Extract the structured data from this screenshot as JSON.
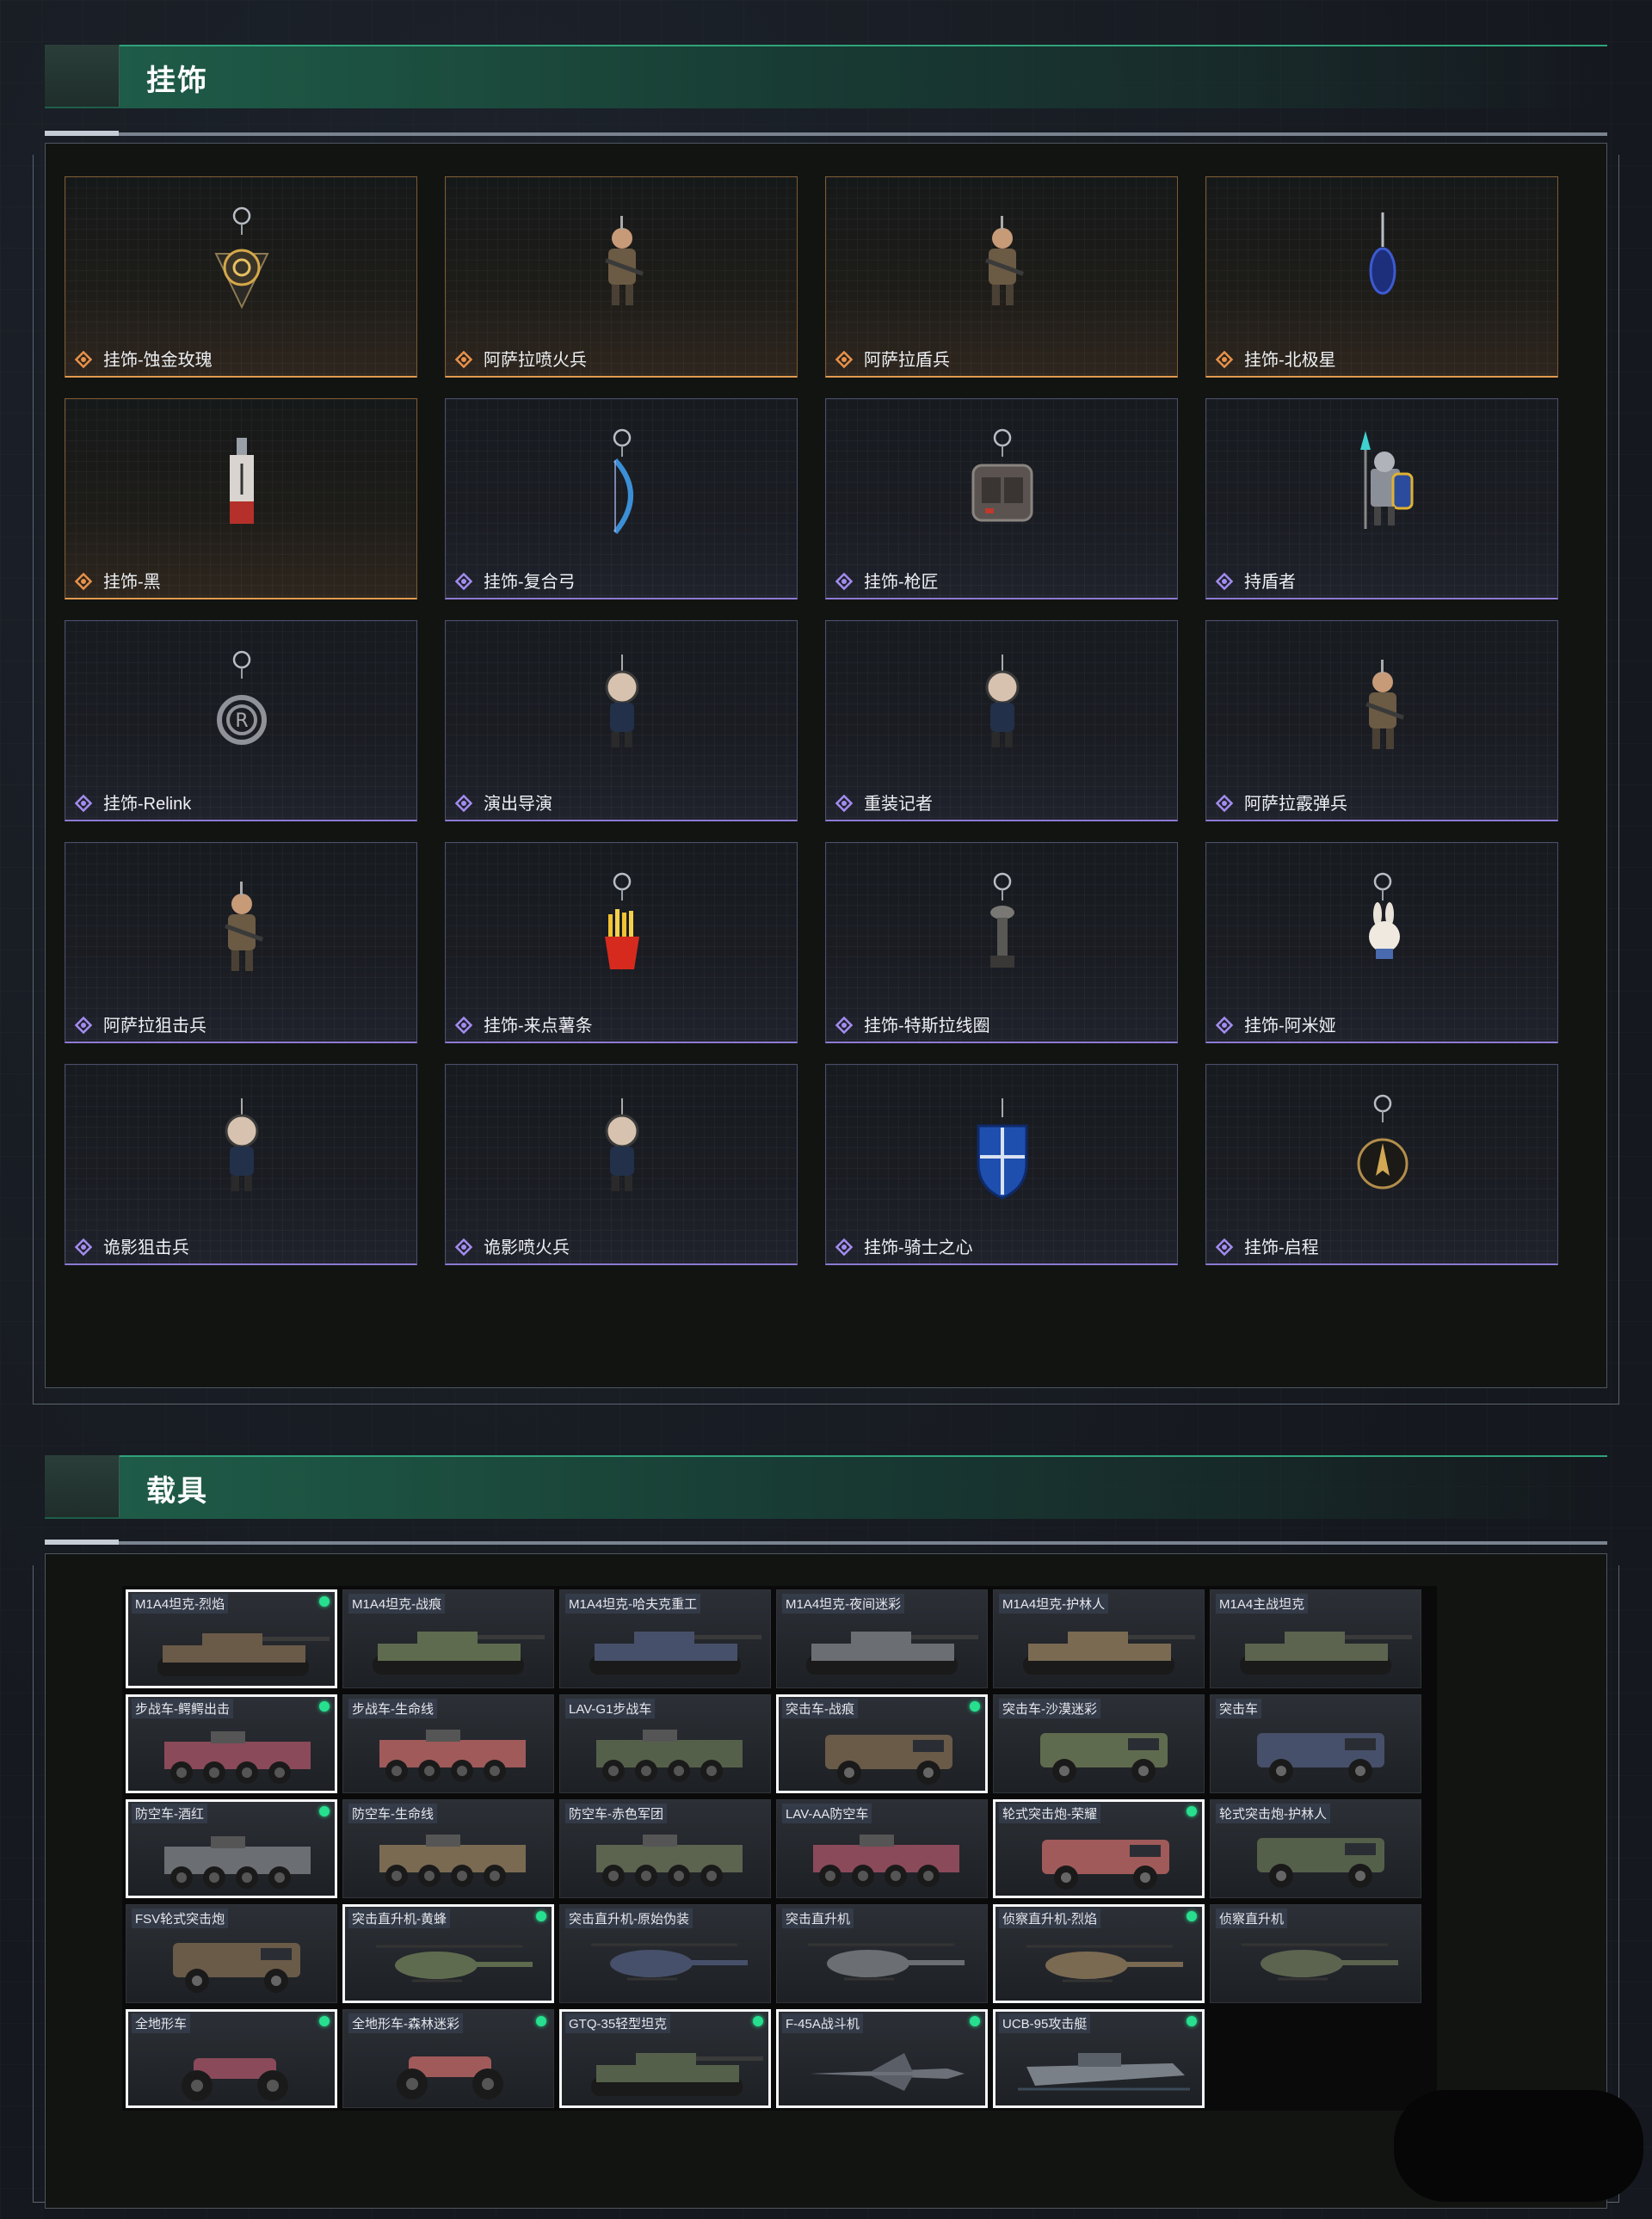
{
  "sections": {
    "pendants": {
      "title": "挂饰"
    },
    "vehicles": {
      "title": "载具"
    }
  },
  "colors": {
    "accent_green": "#2fa37a",
    "rarity_gold": "#e39a4f",
    "rarity_purple": "#8d7ad4",
    "owned_indicator": "#27e08f"
  },
  "pendants": [
    {
      "name": "挂饰-蚀金玫瑰",
      "rarity": "gold",
      "icon": "rose-medallion-icon"
    },
    {
      "name": "阿萨拉喷火兵",
      "rarity": "gold",
      "icon": "soldier-figure-icon"
    },
    {
      "name": "阿萨拉盾兵",
      "rarity": "gold",
      "icon": "soldier-figure-icon"
    },
    {
      "name": "挂饰-北极星",
      "rarity": "gold",
      "icon": "blue-charm-icon"
    },
    {
      "name": "挂饰-黑",
      "rarity": "gold",
      "icon": "tag-charm-icon"
    },
    {
      "name": "挂饰-复合弓",
      "rarity": "purple",
      "icon": "bow-charm-icon"
    },
    {
      "name": "挂饰-枪匠",
      "rarity": "purple",
      "icon": "case-charm-icon"
    },
    {
      "name": "持盾者",
      "rarity": "purple",
      "icon": "shield-bearer-icon"
    },
    {
      "name": "挂饰-Relink",
      "rarity": "purple",
      "icon": "relink-knot-icon"
    },
    {
      "name": "演出导演",
      "rarity": "purple",
      "icon": "chibi-figure-icon"
    },
    {
      "name": "重装记者",
      "rarity": "purple",
      "icon": "chibi-figure-icon"
    },
    {
      "name": "阿萨拉霰弹兵",
      "rarity": "purple",
      "icon": "soldier-figure-icon"
    },
    {
      "name": "阿萨拉狙击兵",
      "rarity": "purple",
      "icon": "soldier-figure-icon"
    },
    {
      "name": "挂饰-来点薯条",
      "rarity": "purple",
      "icon": "fries-charm-icon"
    },
    {
      "name": "挂饰-特斯拉线圈",
      "rarity": "purple",
      "icon": "tesla-coil-icon"
    },
    {
      "name": "挂饰-阿米娅",
      "rarity": "purple",
      "icon": "bunny-charm-icon"
    },
    {
      "name": "诡影狙击兵",
      "rarity": "purple",
      "icon": "chibi-figure-icon"
    },
    {
      "name": "诡影喷火兵",
      "rarity": "purple",
      "icon": "chibi-figure-icon"
    },
    {
      "name": "挂饰-骑士之心",
      "rarity": "purple",
      "icon": "knight-heart-icon"
    },
    {
      "name": "挂饰-启程",
      "rarity": "purple",
      "icon": "compass-charm-icon"
    }
  ],
  "vehicles": [
    {
      "name": "M1A4坦克-烈焰",
      "selected": true,
      "owned": true,
      "kind": "tank"
    },
    {
      "name": "M1A4坦克-战痕",
      "selected": false,
      "owned": false,
      "kind": "tank"
    },
    {
      "name": "M1A4坦克-哈夫克重工",
      "selected": false,
      "owned": false,
      "kind": "tank"
    },
    {
      "name": "M1A4坦克-夜间迷彩",
      "selected": false,
      "owned": false,
      "kind": "tank"
    },
    {
      "name": "M1A4坦克-护林人",
      "selected": false,
      "owned": false,
      "kind": "tank"
    },
    {
      "name": "M1A4主战坦克",
      "selected": false,
      "owned": false,
      "kind": "tank"
    },
    {
      "name": "步战车-鳄鳄出击",
      "selected": true,
      "owned": true,
      "kind": "ifv"
    },
    {
      "name": "步战车-生命线",
      "selected": false,
      "owned": false,
      "kind": "ifv"
    },
    {
      "name": "LAV-G1步战车",
      "selected": false,
      "owned": false,
      "kind": "ifv"
    },
    {
      "name": "突击车-战痕",
      "selected": true,
      "owned": true,
      "kind": "armored-car"
    },
    {
      "name": "突击车-沙漠迷彩",
      "selected": false,
      "owned": false,
      "kind": "armored-car"
    },
    {
      "name": "突击车",
      "selected": false,
      "owned": false,
      "kind": "armored-car"
    },
    {
      "name": "防空车-酒红",
      "selected": true,
      "owned": true,
      "kind": "ifv"
    },
    {
      "name": "防空车-生命线",
      "selected": false,
      "owned": false,
      "kind": "ifv"
    },
    {
      "name": "防空车-赤色军团",
      "selected": false,
      "owned": false,
      "kind": "ifv"
    },
    {
      "name": "LAV-AA防空车",
      "selected": false,
      "owned": false,
      "kind": "ifv"
    },
    {
      "name": "轮式突击炮-荣耀",
      "selected": true,
      "owned": true,
      "kind": "armored-car"
    },
    {
      "name": "轮式突击炮-护林人",
      "selected": false,
      "owned": false,
      "kind": "armored-car"
    },
    {
      "name": "FSV轮式突击炮",
      "selected": false,
      "owned": false,
      "kind": "armored-car"
    },
    {
      "name": "突击直升机-黄蜂",
      "selected": true,
      "owned": true,
      "kind": "helicopter"
    },
    {
      "name": "突击直升机-原始伪装",
      "selected": false,
      "owned": false,
      "kind": "helicopter"
    },
    {
      "name": "突击直升机",
      "selected": false,
      "owned": false,
      "kind": "helicopter"
    },
    {
      "name": "侦察直升机-烈焰",
      "selected": true,
      "owned": true,
      "kind": "helicopter"
    },
    {
      "name": "侦察直升机",
      "selected": false,
      "owned": false,
      "kind": "helicopter"
    },
    {
      "name": "全地形车",
      "selected": true,
      "owned": true,
      "kind": "atv"
    },
    {
      "name": "全地形车-森林迷彩",
      "selected": false,
      "owned": true,
      "kind": "atv"
    },
    {
      "name": "GTQ-35轻型坦克",
      "selected": true,
      "owned": true,
      "kind": "tank"
    },
    {
      "name": "F-45A战斗机",
      "selected": true,
      "owned": true,
      "kind": "jet"
    },
    {
      "name": "UCB-95攻击艇",
      "selected": true,
      "owned": true,
      "kind": "boat"
    }
  ]
}
